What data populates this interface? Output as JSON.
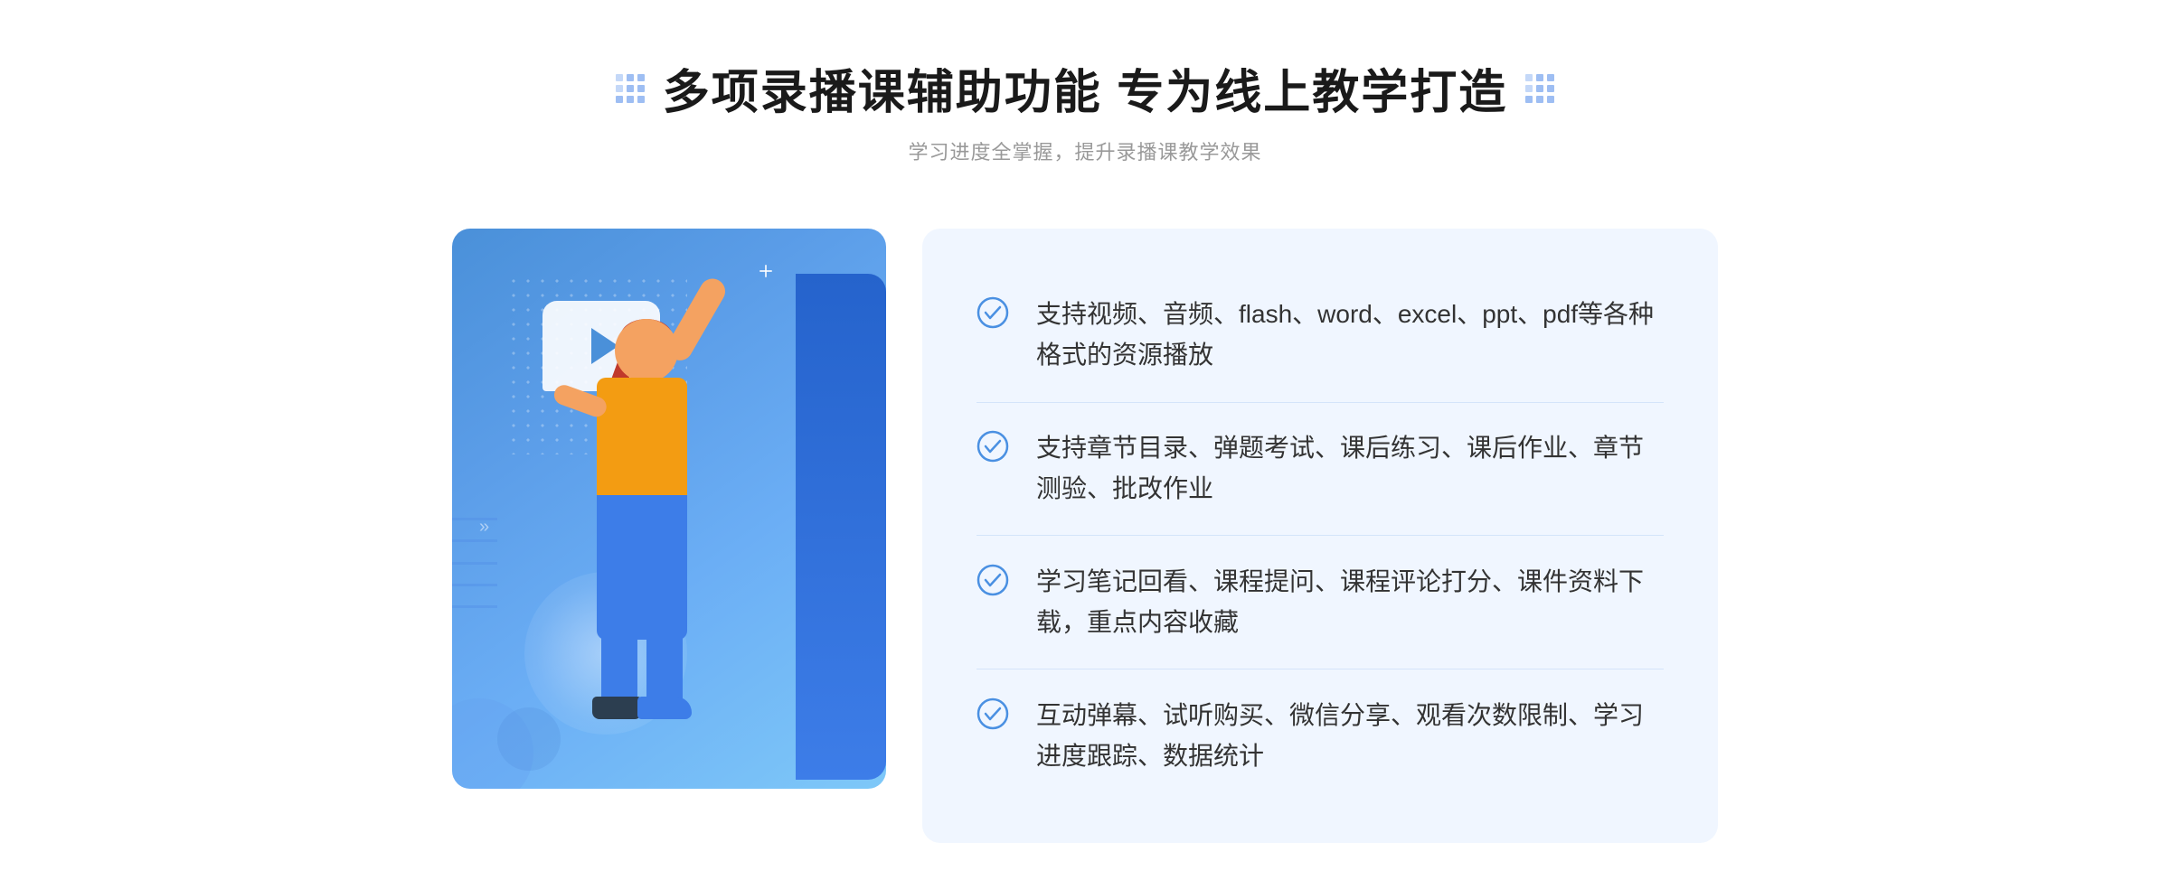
{
  "header": {
    "main_title": "多项录播课辅助功能 专为线上教学打造",
    "subtitle": "学习进度全掌握，提升录播课教学效果"
  },
  "features": [
    {
      "id": 1,
      "text": "支持视频、音频、flash、word、excel、ppt、pdf等各种格式的资源播放"
    },
    {
      "id": 2,
      "text": "支持章节目录、弹题考试、课后练习、课后作业、章节测验、批改作业"
    },
    {
      "id": 3,
      "text": "学习笔记回看、课程提问、课程评论打分、课件资料下载，重点内容收藏"
    },
    {
      "id": 4,
      "text": "互动弹幕、试听购买、微信分享、观看次数限制、学习进度跟踪、数据统计"
    }
  ]
}
